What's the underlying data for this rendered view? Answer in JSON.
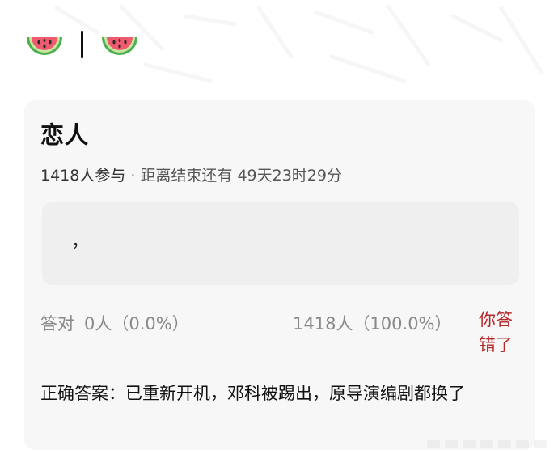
{
  "header": {
    "left_icon": "watermelon-icon",
    "right_icon": "watermelon-icon"
  },
  "poll": {
    "title": "恋人",
    "participants": "1418人参与",
    "separator": "·",
    "countdown": "距离结束还有 49天23时29分",
    "option_text": "，",
    "correct_label": "答对",
    "correct_count": "0人（0.0%）",
    "wrong_count": "1418人（100.0%）",
    "wrong_label": "你答错了",
    "answer": "正确答案：已重新开机，邓科被踢出，原导演编剧都换了"
  },
  "colors": {
    "card_bg": "#f7f7f7",
    "option_bg": "#efefef",
    "wrong_red": "#b5282a",
    "muted_text": "#888888"
  }
}
